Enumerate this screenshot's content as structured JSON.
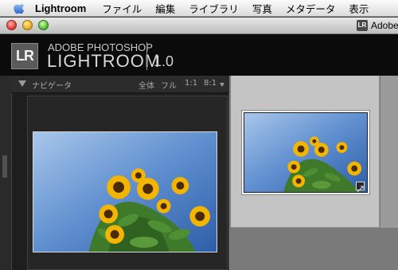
{
  "menubar": {
    "app_name": "Lightroom",
    "items": [
      "ファイル",
      "編集",
      "ライブラリ",
      "写真",
      "メタデータ",
      "表示"
    ]
  },
  "window": {
    "title_icon": "LR",
    "title": "Adobe"
  },
  "identity_plate": {
    "badge": "LR",
    "brand_top": "ADOBE PHOTOSHOP",
    "brand_main": "LIGHTROOM",
    "version": "1.0"
  },
  "navigator": {
    "title": "ナビゲータ",
    "zoom_options": [
      "全体",
      "フル",
      "1:1",
      "8:1"
    ]
  },
  "colors": {
    "sky_top": "#3a6fb4",
    "sky_bottom": "#9fc0e6",
    "petal": "#f2b500",
    "center": "#4a2a08",
    "leaf": "#3f7a2a"
  },
  "icons": {
    "apple": "apple-icon",
    "navigator_toggle": "triangle-down-icon",
    "zoom_menu": "chevron-down-icon",
    "thumbnail_badge": "crop-badge-icon"
  }
}
